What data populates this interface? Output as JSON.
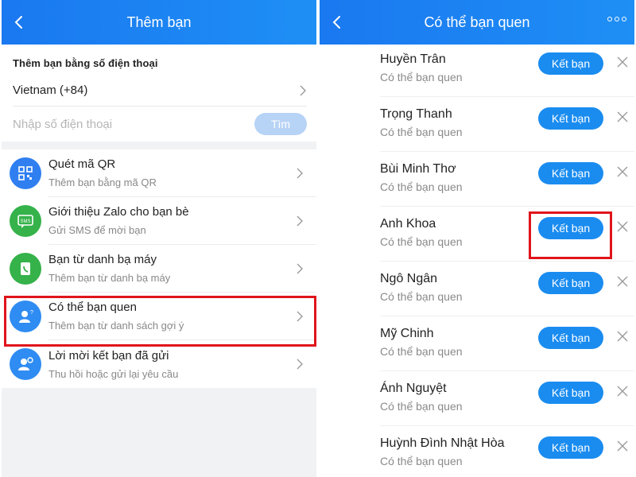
{
  "left": {
    "header_title": "Thêm bạn",
    "section_label": "Thêm bạn bằng số điện thoại",
    "country": "Vietnam (+84)",
    "phone_placeholder": "Nhập số điện thoại",
    "search_label": "Tìm",
    "menu": [
      {
        "title": "Quét mã QR",
        "subtitle": "Thêm bạn bằng mã QR",
        "icon": "qr-code-icon",
        "color": "#2f7ff0"
      },
      {
        "title": "Giới thiệu Zalo cho bạn bè",
        "subtitle": "Gửi SMS để mời bạn",
        "icon": "sms-icon",
        "color": "#35b24a"
      },
      {
        "title": "Bạn từ danh bạ máy",
        "subtitle": "Thêm bạn từ danh bạ máy",
        "icon": "phone-contacts-icon",
        "color": "#35b24a"
      },
      {
        "title": "Có thể bạn quen",
        "subtitle": "Thêm bạn từ danh sách gợi ý",
        "icon": "suggested-friends-icon",
        "color": "#2f8cf2"
      },
      {
        "title": "Lời mời kết bạn đã gửi",
        "subtitle": "Thu hồi hoặc gửi lại yêu cầu",
        "icon": "sent-request-icon",
        "color": "#2f8cf2"
      }
    ]
  },
  "right": {
    "header_title": "Có thể bạn quen",
    "add_label": "Kết bạn",
    "friends": [
      {
        "name": "Huyền Trân",
        "subtitle": "Có thể bạn quen"
      },
      {
        "name": "Trọng Thanh",
        "subtitle": "Có thể bạn quen"
      },
      {
        "name": "Bùi Minh Thơ",
        "subtitle": "Có thể bạn quen"
      },
      {
        "name": "Anh Khoa",
        "subtitle": "Có thể bạn quen"
      },
      {
        "name": "Ngô Ngân",
        "subtitle": "Có thể bạn quen"
      },
      {
        "name": "Mỹ Chinh",
        "subtitle": "Có thể bạn quen"
      },
      {
        "name": "Ánh Nguyệt",
        "subtitle": "Có thể bạn quen"
      },
      {
        "name": "Huỳnh Đình Nhật Hòa",
        "subtitle": "Có thể bạn quen"
      }
    ]
  },
  "colors": {
    "header": "#1a78f0",
    "button": "#1a8cf0",
    "highlight": "#e0141b",
    "search_button": "#b7d3f5"
  }
}
